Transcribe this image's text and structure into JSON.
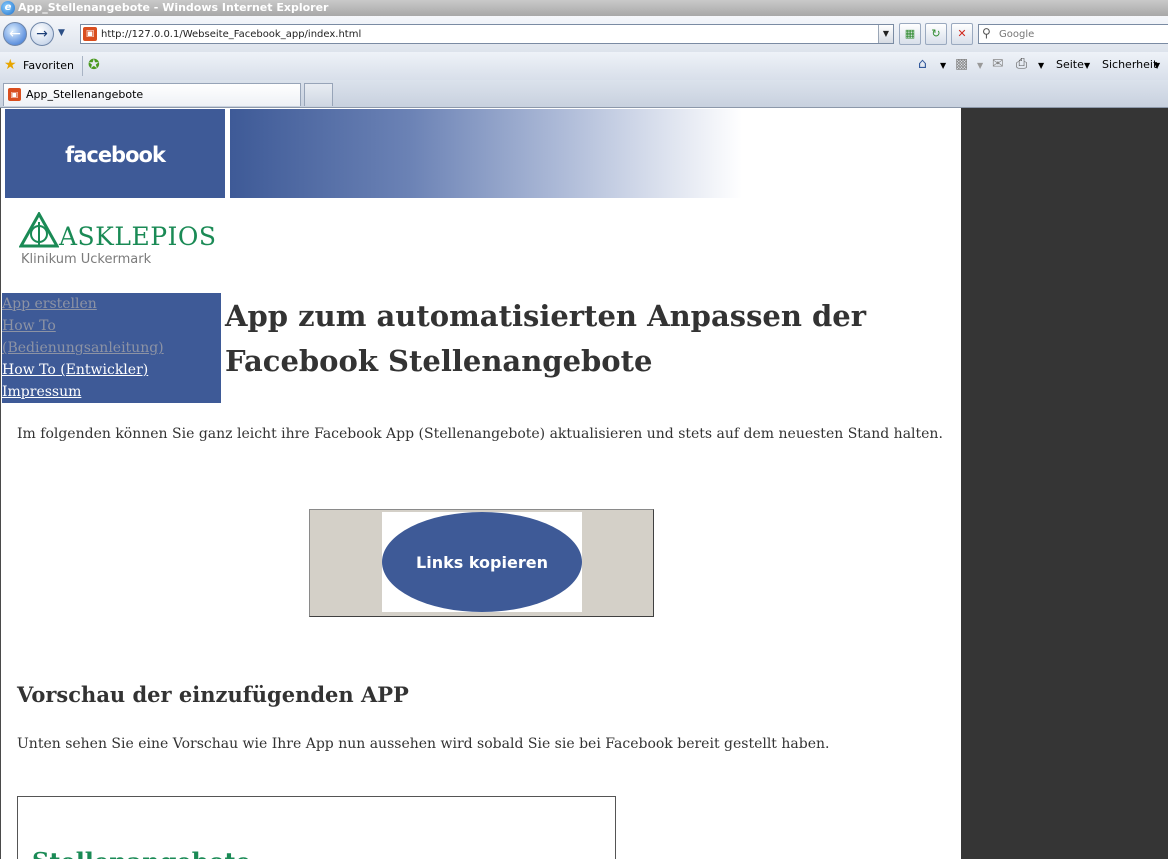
{
  "window": {
    "title": "App_Stellenangebote - Windows Internet Explorer"
  },
  "addressbar": {
    "url": "http://127.0.0.1/Webseite_Facebook_app/index.html",
    "search_placeholder": "Google"
  },
  "favorites": {
    "label": "Favoriten"
  },
  "commandbar": {
    "seite": "Seite",
    "sicherheit": "Sicherheit"
  },
  "tabs": [
    {
      "label": "App_Stellenangebote"
    }
  ],
  "page": {
    "banner_logo": "facebook",
    "brand": {
      "name": "ASKLEPIOS",
      "subtitle": "Klinikum Uckermark",
      "color": "#1a8a55"
    },
    "menu": [
      {
        "label": "App erstellen",
        "visited": true
      },
      {
        "label": "How To (Bedienungsanleitung)",
        "visited": true
      },
      {
        "label": "How To (Entwickler)",
        "visited": false
      },
      {
        "label": "Impressum",
        "visited": false
      }
    ],
    "title": "App zum automatisierten Anpassen der Facebook Stellenangebote",
    "intro": "Im folgenden können Sie ganz leicht ihre Facebook App (Stellenangebote) aktualisieren und stets auf dem neuesten Stand halten.",
    "copy_button": "Links kopieren",
    "preview_title": "Vorschau der einzufügenden APP",
    "preview_text": "Unten sehen Sie eine Vorschau wie Ihre App nun aussehen wird sobald Sie sie bei Facebook bereit gestellt haben.",
    "preview_heading": "Stellenangebote",
    "accent_color": "#3e5a97"
  }
}
